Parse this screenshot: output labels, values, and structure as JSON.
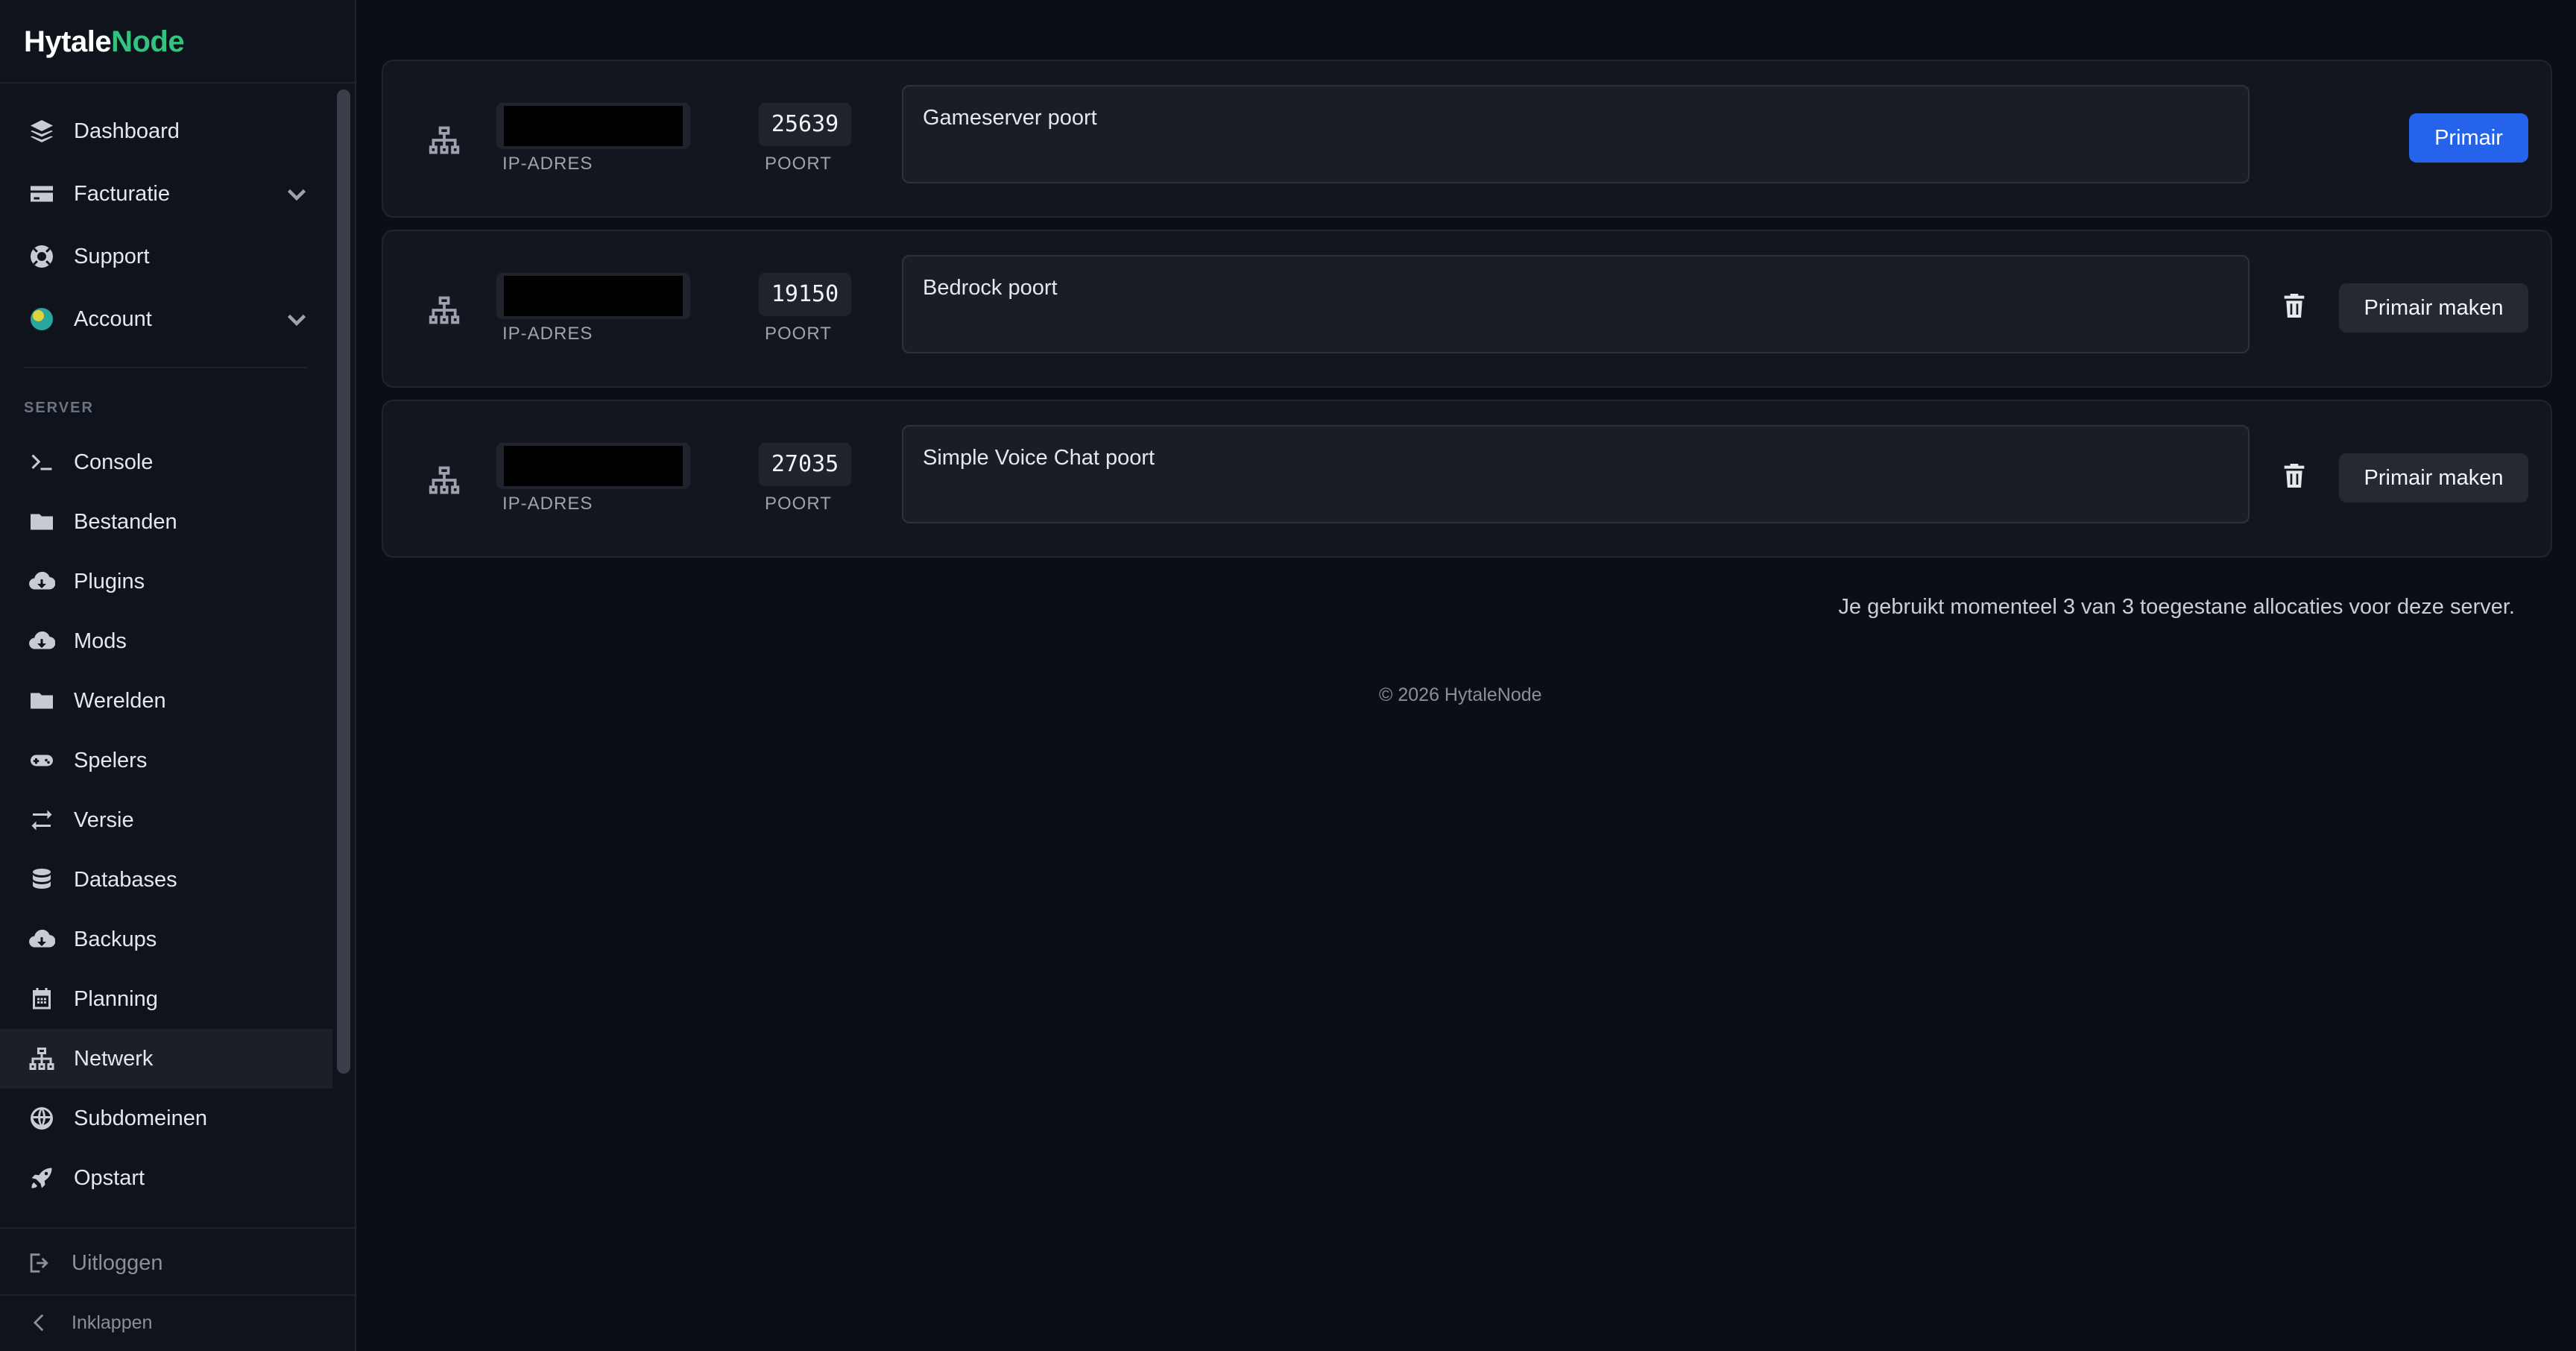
{
  "brand": {
    "part1": "Hytale",
    "part2": "Node"
  },
  "sidebar": {
    "top_items": [
      {
        "label": "Dashboard",
        "icon": "layers-icon"
      },
      {
        "label": "Facturatie",
        "icon": "credit-card-icon"
      },
      {
        "label": "Support",
        "icon": "lifebuoy-icon"
      },
      {
        "label": "Account",
        "icon": "avatar-icon"
      }
    ],
    "section_label": "SERVER",
    "server_items": [
      {
        "label": "Console",
        "icon": "terminal-icon"
      },
      {
        "label": "Bestanden",
        "icon": "folder-icon"
      },
      {
        "label": "Plugins",
        "icon": "cloud-download-icon"
      },
      {
        "label": "Mods",
        "icon": "cloud-download-icon"
      },
      {
        "label": "Werelden",
        "icon": "folder-icon"
      },
      {
        "label": "Spelers",
        "icon": "gamepad-icon"
      },
      {
        "label": "Versie",
        "icon": "arrows-exchange-icon"
      },
      {
        "label": "Databases",
        "icon": "database-icon"
      },
      {
        "label": "Backups",
        "icon": "cloud-download-icon"
      },
      {
        "label": "Planning",
        "icon": "calendar-icon"
      },
      {
        "label": "Netwerk",
        "icon": "network-icon"
      },
      {
        "label": "Subdomeinen",
        "icon": "globe-icon"
      },
      {
        "label": "Opstart",
        "icon": "rocket-icon"
      }
    ],
    "logout": "Uitloggen",
    "collapse": "Inklappen"
  },
  "allocations": [
    {
      "port": "25639",
      "ip_label": "IP-ADRES",
      "port_label": "POORT",
      "note": "Gameserver poort",
      "button": "Primair",
      "primary": true
    },
    {
      "port": "19150",
      "ip_label": "IP-ADRES",
      "port_label": "POORT",
      "note": "Bedrock poort",
      "button": "Primair maken",
      "primary": false
    },
    {
      "port": "27035",
      "ip_label": "IP-ADRES",
      "port_label": "POORT",
      "note": "Simple Voice Chat poort",
      "button": "Primair maken",
      "primary": false
    }
  ],
  "usage_text": "Je gebruikt momenteel 3 van 3 toegestane allocaties voor deze server.",
  "copyright": "© 2026 HytaleNode",
  "colors": {
    "accent": "#34c37f",
    "primary_button": "#2563eb"
  }
}
